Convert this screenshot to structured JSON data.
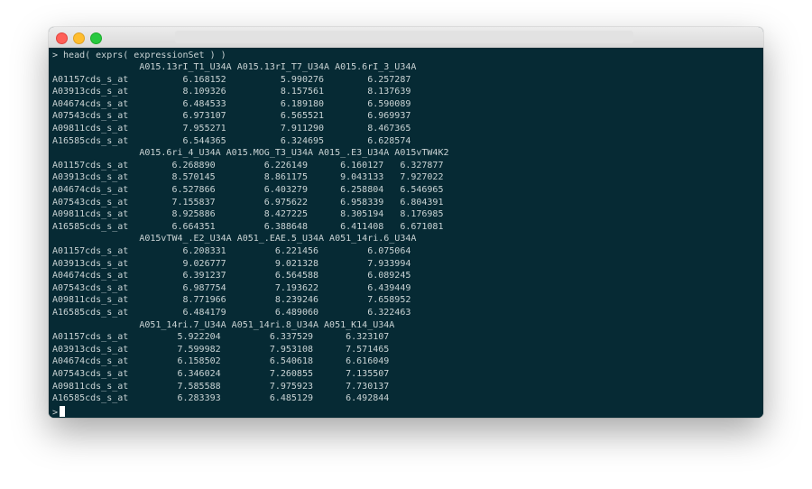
{
  "terminal": {
    "command": "> head( exprs( expressionSet ) )",
    "prompt": ">",
    "lines": [
      "                A015.13rI_T1_U34A A015.13rI_T7_U34A A015.6rI_3_U34A",
      "A01157cds_s_at          6.168152          5.990276        6.257287",
      "A03913cds_s_at          8.109326          8.157561        8.137639",
      "A04674cds_s_at          6.484533          6.189180        6.590089",
      "A07543cds_s_at          6.973107          6.565521        6.969937",
      "A09811cds_s_at          7.955271          7.911290        8.467365",
      "A16585cds_s_at          6.544365          6.324695        6.628574",
      "                A015.6ri_4_U34A A015.MOG_T3_U34A A015_.E3_U34A A015vTW4K2",
      "A01157cds_s_at        6.268890         6.226149      6.160127   6.327877",
      "A03913cds_s_at        8.570145         8.861175      9.043133   7.927022",
      "A04674cds_s_at        6.527866         6.403279      6.258804   6.546965",
      "A07543cds_s_at        7.155837         6.975622      6.958339   6.804391",
      "A09811cds_s_at        8.925886         8.427225      8.305194   8.176985",
      "A16585cds_s_at        6.664351         6.388648      6.411408   6.671081",
      "                A015vTW4_.E2_U34A A051_.EAE.5_U34A A051_14ri.6_U34A",
      "A01157cds_s_at          6.208331         6.221456         6.075064",
      "A03913cds_s_at          9.026777         9.021328         7.933994",
      "A04674cds_s_at          6.391237         6.564588         6.089245",
      "A07543cds_s_at          6.987754         7.193622         6.439449",
      "A09811cds_s_at          8.771966         8.239246         7.658952",
      "A16585cds_s_at          6.484179         6.489060         6.322463",
      "                A051_14ri.7_U34A A051_14ri.8_U34A A051_K14_U34A",
      "A01157cds_s_at         5.922204         6.337529      6.323107",
      "A03913cds_s_at         7.599982         7.953108      7.571465",
      "A04674cds_s_at         6.158502         6.540618      6.616049",
      "A07543cds_s_at         6.346024         7.260855      7.135507",
      "A09811cds_s_at         7.585588         7.975923      7.730137",
      "A16585cds_s_at         6.283393         6.485129      6.492844"
    ]
  },
  "colors": {
    "terminal_background": "#062a34",
    "terminal_text": "#c9d3d4",
    "close": "#ff5f57",
    "minimize": "#ffbd2e",
    "zoom": "#28c940"
  }
}
